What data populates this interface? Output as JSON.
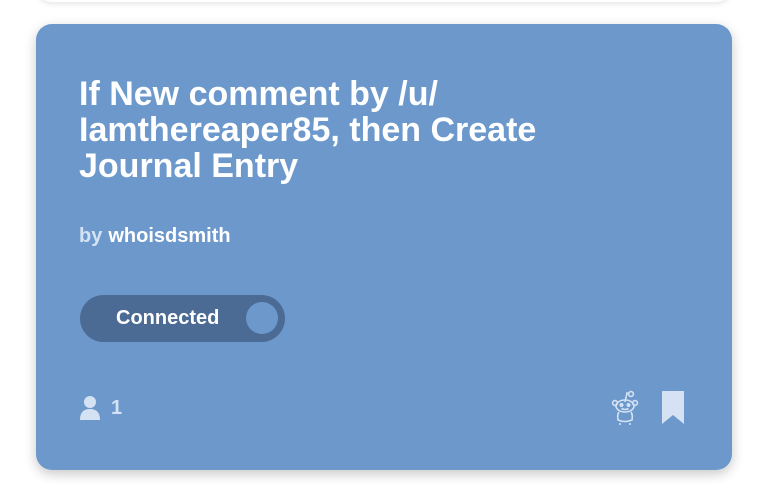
{
  "applet": {
    "title": "If New comment by /u/ Iamthereaper85, then Create Journal Entry",
    "by_label": "by",
    "author": "whoisdsmith",
    "toggle_label": "Connected",
    "user_count": "1",
    "service_icon": "reddit-icon",
    "bookmark_icon": "bookmark-icon",
    "colors": {
      "card": "#6c98cc",
      "toggle": "#4b6a94",
      "text": "#ffffff",
      "muted_text": "#d4e2f3"
    }
  }
}
